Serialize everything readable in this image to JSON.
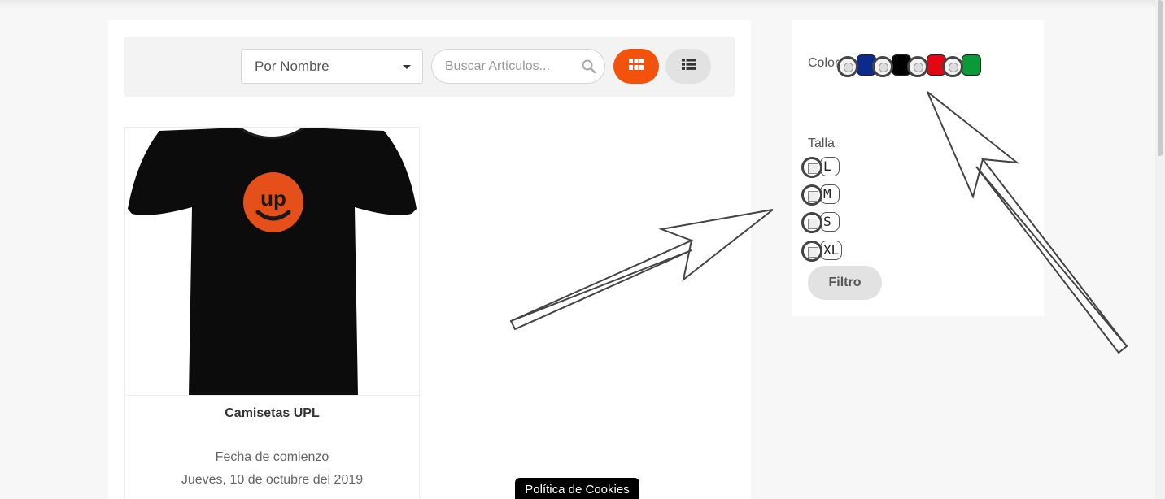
{
  "toolbar": {
    "sort_selected": "Por Nombre",
    "search_placeholder": "Buscar Artículos..."
  },
  "product": {
    "title": "Camisetas UPL",
    "logo_text": "up",
    "date_label": "Fecha de comienzo",
    "date_value": "Jueves, 10 de octubre del 2019"
  },
  "filters": {
    "color_label": "Color",
    "colors": [
      "#0b2a8c",
      "#000000",
      "#e30613",
      "#0a9a3a"
    ],
    "size_label": "Talla",
    "sizes": [
      "L",
      "M",
      "S",
      "XL"
    ],
    "filter_button": "Filtro"
  },
  "cookie_banner": "Política de Cookies",
  "colors": {
    "accent": "#f2520c",
    "panel_bg": "#ffffff",
    "page_bg": "#f7f7f7"
  }
}
